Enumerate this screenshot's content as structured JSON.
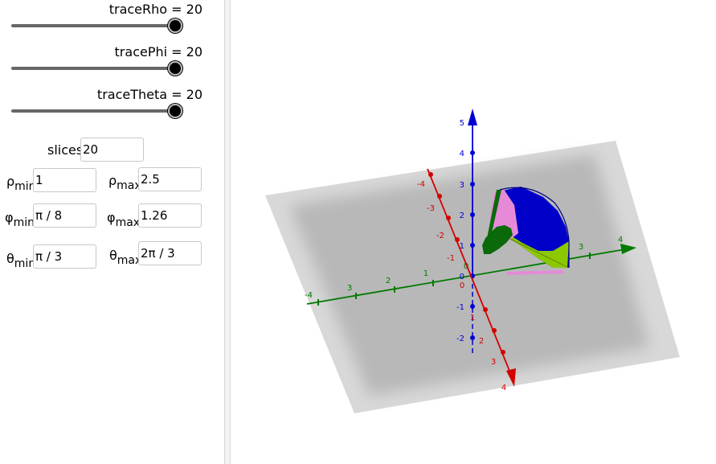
{
  "sliders": [
    {
      "label": "traceRho = 20",
      "value": 20,
      "min": 0,
      "max": 20
    },
    {
      "label": "tracePhi = 20",
      "value": 20,
      "min": 0,
      "max": 20
    },
    {
      "label": "traceTheta = 20",
      "value": 20,
      "min": 0,
      "max": 20
    }
  ],
  "slices": {
    "label": "slices",
    "value": "20"
  },
  "params": {
    "rho_min": {
      "symbol": "ρ",
      "sub": "min",
      "value": "1"
    },
    "rho_max": {
      "symbol": "ρ",
      "sub": "max",
      "value": "2.5"
    },
    "phi_min": {
      "symbol": "φ",
      "sub": "min",
      "value": "π / 8"
    },
    "phi_max": {
      "symbol": "φ",
      "sub": "max",
      "value": "1.26"
    },
    "theta_min": {
      "symbol": "θ",
      "sub": "min",
      "value": "π / 3"
    },
    "theta_max": {
      "symbol": "θ",
      "sub": "max",
      "value": "2π / 3"
    }
  },
  "axes": {
    "x_color": "#d40000",
    "y_color": "#007a00",
    "z_color": "#0000d4",
    "x_ticks": [
      "-4",
      "-3",
      "-2",
      "-1",
      "0",
      "1",
      "2",
      "3",
      "4"
    ],
    "y_ticks": [
      "-4",
      "3",
      "2",
      "1",
      "0",
      "3",
      "4"
    ],
    "z_ticks": [
      "5",
      "4",
      "3",
      "2",
      "1",
      "0",
      "-1",
      "-2"
    ]
  },
  "surface_colors": {
    "blue": "#0000c8",
    "green": "#8cc800",
    "pink": "#e68ad8",
    "dark_green": "#0a6a0a"
  }
}
